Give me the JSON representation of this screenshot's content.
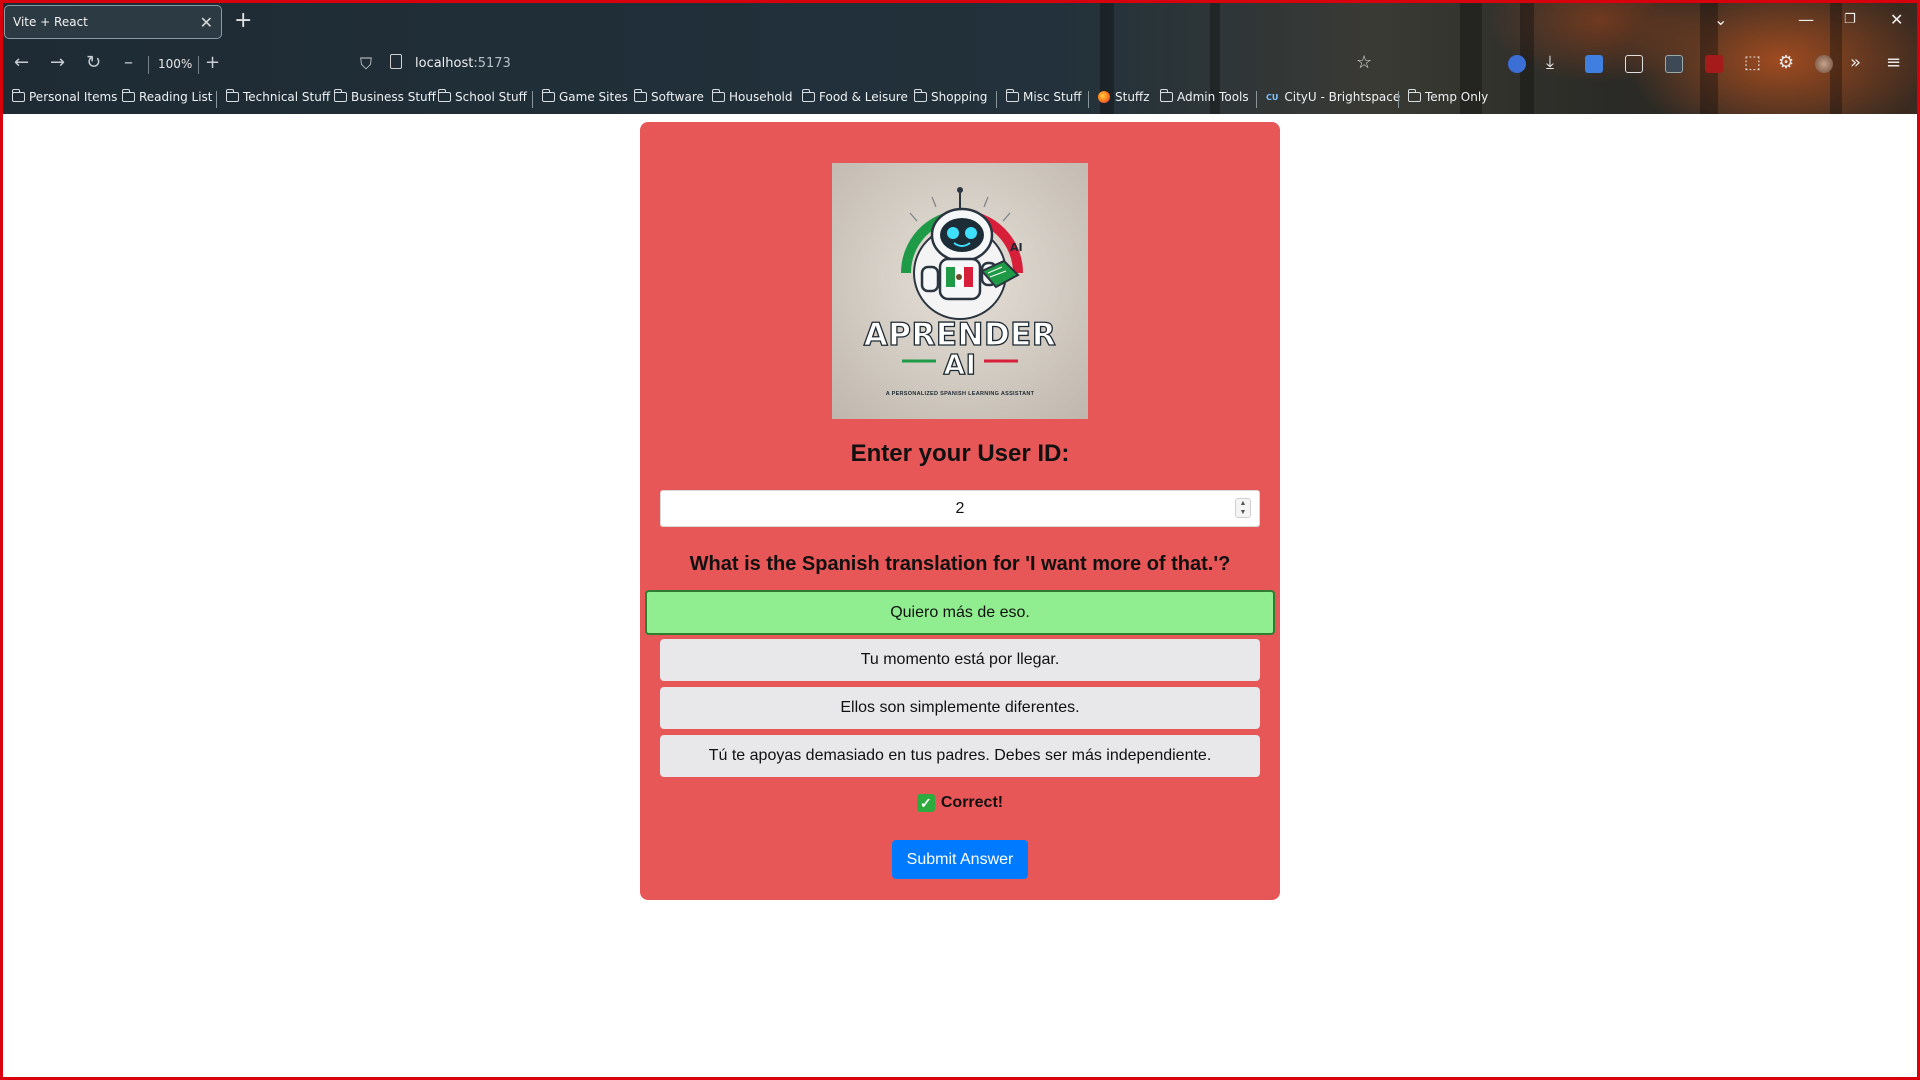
{
  "browser": {
    "tab_title": "Vite + React",
    "tab_close": "✕",
    "new_tab": "+",
    "zoom": "100%",
    "url_host": "localhost",
    "url_port": ":5173",
    "bookmarks": [
      {
        "label": "Personal Items"
      },
      {
        "label": "Reading List"
      },
      {
        "label": "Technical Stuff"
      },
      {
        "label": "Business Stuff"
      },
      {
        "label": "School Stuff"
      },
      {
        "label": "Game Sites"
      },
      {
        "label": "Software"
      },
      {
        "label": "Household"
      },
      {
        "label": "Food & Leisure"
      },
      {
        "label": "Shopping"
      },
      {
        "label": "Misc Stuff"
      },
      {
        "label": "Stuffz"
      },
      {
        "label": "Admin Tools"
      },
      {
        "label": "CityU - Brightspace"
      },
      {
        "label": "Temp Only"
      }
    ]
  },
  "logo": {
    "title": "APRENDER",
    "ai": "AI",
    "badge_ai": "AI",
    "subtitle": "A PERSONALIZED SPANISH LEARNING ASSISTANT"
  },
  "form": {
    "heading": "Enter your User ID:",
    "user_id_value": "2"
  },
  "quiz": {
    "question": "What is the Spanish translation for 'I want more of that.'?",
    "options": [
      {
        "text": "Quiero más de eso.",
        "selected": true
      },
      {
        "text": "Tu momento está por llegar.",
        "selected": false
      },
      {
        "text": "Ellos son simplemente diferentes.",
        "selected": false
      },
      {
        "text": "Tú te apoyas demasiado en tus padres. Debes ser más independiente.",
        "selected": false
      }
    ],
    "feedback": "Correct!",
    "feedback_icon": "✓",
    "submit_label": "Submit Answer"
  },
  "colors": {
    "card_bg": "#e85757",
    "selected_option": "#90ee90",
    "option_bg": "#e8e8ea",
    "submit_bg": "#007bff"
  }
}
